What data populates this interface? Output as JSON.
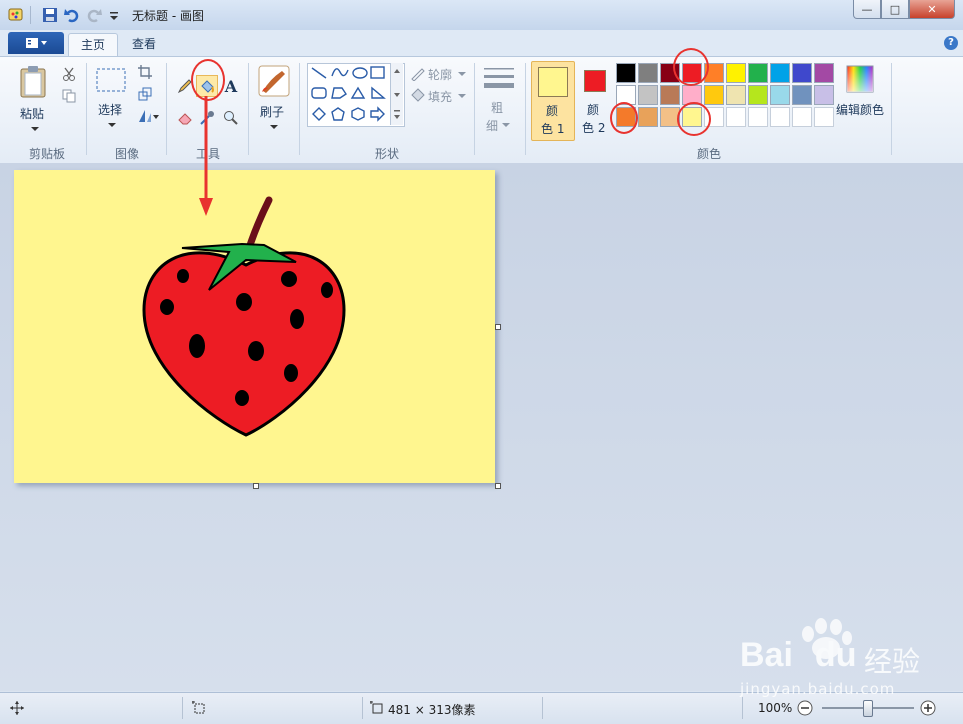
{
  "window": {
    "title": "无标题 - 画图",
    "controls": {
      "minimize": "—",
      "maximize": "□",
      "close": "✕"
    }
  },
  "tabs": [
    {
      "label": "主页",
      "active": true
    },
    {
      "label": "查看",
      "active": false
    }
  ],
  "help_label": "?",
  "ribbon": {
    "clipboard": {
      "paste_label": "粘贴",
      "group_label": "剪贴板"
    },
    "image": {
      "select_label": "选择",
      "group_label": "图像"
    },
    "tools": {
      "text_tool_glyph": "A",
      "group_label": "工具"
    },
    "brushes": {
      "label": "刷子"
    },
    "shapes": {
      "outline_label": "轮廓",
      "fill_label": "填充",
      "group_label": "形状"
    },
    "size": {
      "label_line1": "粗",
      "label_line2": "细"
    },
    "colors": {
      "color1": {
        "label_line1": "颜",
        "label_line2": "色 1",
        "value": "#fff68f"
      },
      "color2": {
        "label_line1": "颜",
        "label_line2": "色 2",
        "value": "#ed1c24"
      },
      "row1": [
        "#000000",
        "#7f7f7f",
        "#880015",
        "#ed1c24",
        "#ff7f27",
        "#fff200",
        "#22b14c",
        "#00a2e8",
        "#3f48cc",
        "#a349a4"
      ],
      "row2": [
        "#ffffff",
        "#c3c3c3",
        "#b97a57",
        "#ffaec9",
        "#ffc90e",
        "#efe4b0",
        "#b5e61d",
        "#99d9ea",
        "#7092be",
        "#c8bfe7"
      ],
      "row3": [
        "#f47a2a",
        "#e8a25a",
        "#f3c087",
        "#fff68f",
        "",
        "",
        "",
        "",
        "",
        ""
      ],
      "edit_label": "编辑颜色",
      "group_label": "颜色"
    }
  },
  "canvas": {
    "background": "#fff68f",
    "strawberry_color": "#ed1c24",
    "leaf_color": "#22b14c"
  },
  "status": {
    "size_text": "481 × 313像素",
    "zoom_text": "100%",
    "zoom_fraction": 0.5
  },
  "annotation_color": "#e8332f",
  "watermark": {
    "brand": "Bai",
    "brand2": "du",
    "cn": "经验",
    "url": "jingyan.baidu.com"
  }
}
